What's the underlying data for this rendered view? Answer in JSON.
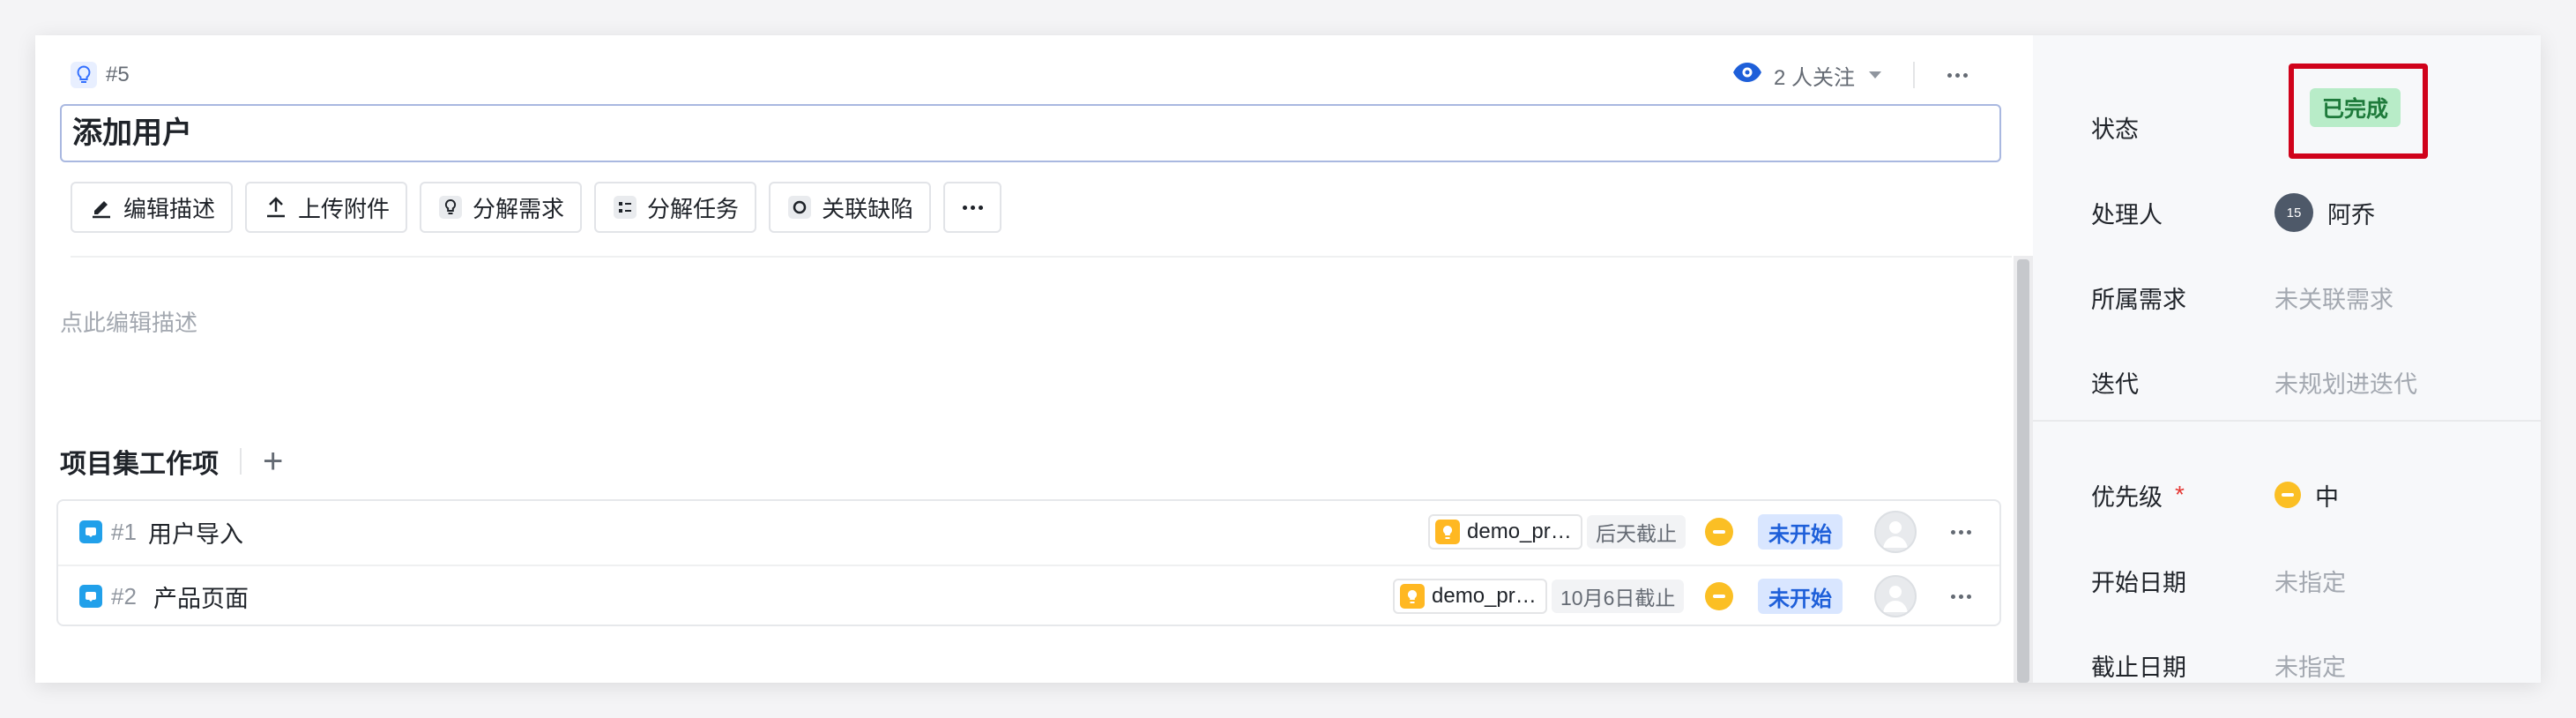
{
  "item": {
    "id": "#5",
    "title": "添加用户",
    "description_placeholder": "点此编辑描述"
  },
  "watch": {
    "label": "2 人关注"
  },
  "toolbar": {
    "edit_desc": "编辑描述",
    "upload": "上传附件",
    "split_req": "分解需求",
    "split_task": "分解任务",
    "link_bug": "关联缺陷"
  },
  "section": {
    "title": "项目集工作项"
  },
  "work_items": [
    {
      "id": "#1",
      "name": "用户导入",
      "project": "demo_pr…",
      "due": "后天截止",
      "status": "未开始"
    },
    {
      "id": "#2",
      "name": "产品页面",
      "project": "demo_pr…",
      "due": "10月6日截止",
      "status": "未开始"
    }
  ],
  "properties": {
    "status_label": "状态",
    "status_value": "已完成",
    "assignee_label": "处理人",
    "assignee_avatar": "15",
    "assignee_name": "阿乔",
    "requirement_label": "所属需求",
    "requirement_value": "未关联需求",
    "iteration_label": "迭代",
    "iteration_value": "未规划进迭代",
    "priority_label": "优先级",
    "priority_required": "*",
    "priority_value": "中",
    "start_label": "开始日期",
    "start_value": "未指定",
    "due_label": "截止日期",
    "due_value": "未指定"
  },
  "colors": {
    "accent_blue": "#1e5fd9",
    "done_green": "#b8ecc8",
    "priority_yellow": "#fbbf24",
    "highlight_red": "#d0021b"
  },
  "icons": [
    "bulb-icon",
    "eye-icon",
    "chevron-down-icon",
    "more-icon",
    "pencil-icon",
    "upload-icon",
    "split-requirement-icon",
    "split-task-icon",
    "link-bug-icon",
    "plus-icon",
    "task-type-icon",
    "project-icon",
    "avatar-placeholder-icon"
  ]
}
